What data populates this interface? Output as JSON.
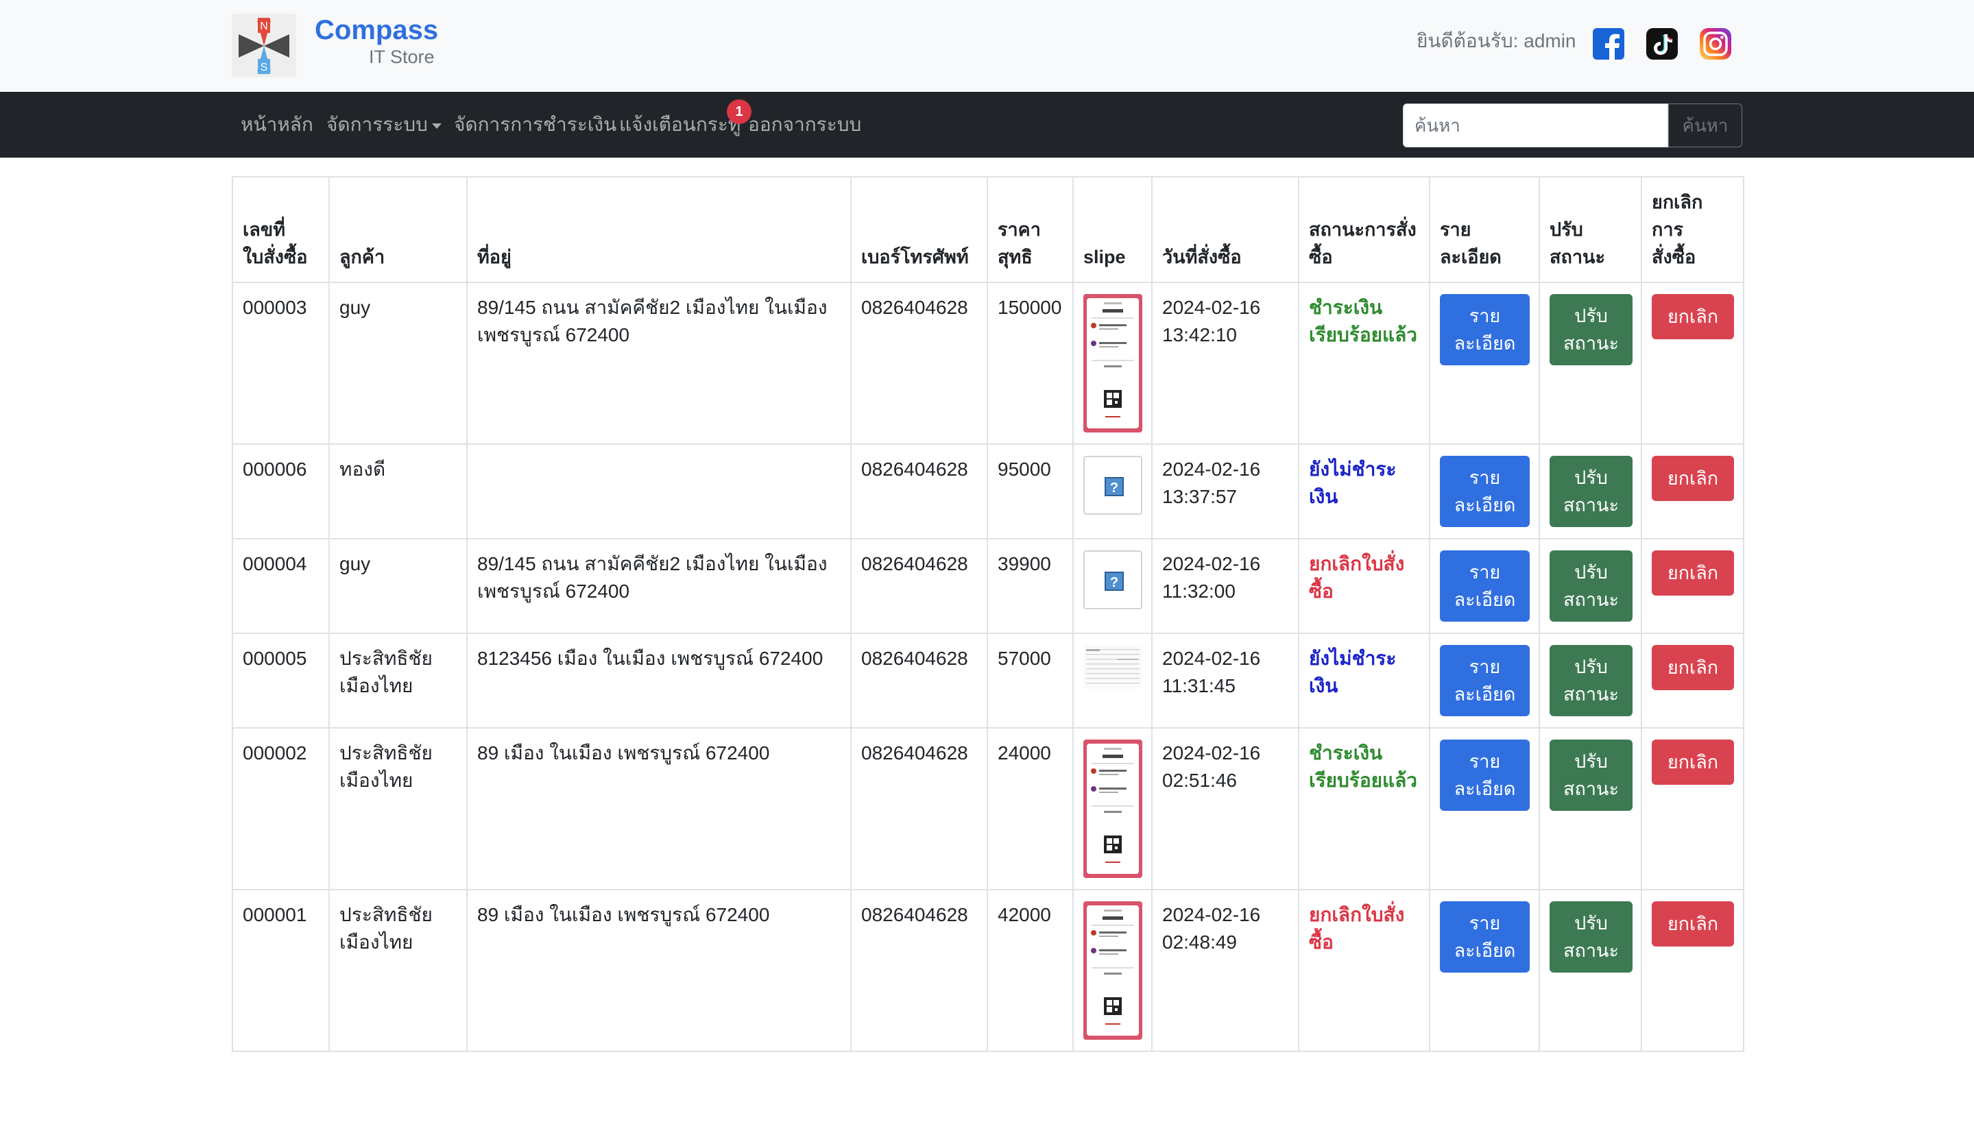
{
  "brand": {
    "name": "Compass",
    "subtitle": "IT Store",
    "logo_letters": {
      "north": "N",
      "south": "S"
    }
  },
  "header": {
    "welcome": "ยินดีต้อนรับ: admin",
    "social": [
      "facebook-icon",
      "tiktok-icon",
      "instagram-icon"
    ]
  },
  "nav": {
    "home": "หน้าหลัก",
    "manage_system": "จัดการระบบ",
    "manage_payment": "จัดการการชำระเงิน",
    "notifications": "แจ้งเตือนกระทู้",
    "notifications_badge": "1",
    "logout": "ออกจากระบบ"
  },
  "search": {
    "placeholder": "ค้นหา",
    "button": "ค้นหา"
  },
  "table": {
    "headers": {
      "order_no": [
        "เลขที่",
        "ใบสั่งซื้อ"
      ],
      "customer": "ลูกค้า",
      "address": "ที่อยู่",
      "phone": "เบอร์โทรศัพท์",
      "net_price": [
        "ราคา",
        "สุทธิ"
      ],
      "slip": "slipe",
      "order_date": "วันที่สั่งซื้อ",
      "status": [
        "สถานะการสั่ง",
        "ซื้อ"
      ],
      "details": [
        "ราย",
        "ละเอียด"
      ],
      "adjust": [
        "ปรับ",
        "สถานะ"
      ],
      "cancel": [
        "ยกเลิกการ",
        "สั่งซื้อ"
      ]
    },
    "buttons": {
      "details": [
        "ราย",
        "ละเอียด"
      ],
      "adjust": [
        "ปรับ",
        "สถานะ"
      ],
      "cancel": "ยกเลิก"
    },
    "rows": [
      {
        "order_no": "000003",
        "customer": "guy",
        "address": "89/145 ถนน สามัคคีชัย2 เมืองไทย ในเมือง เพชรบูรณ์ 672400",
        "phone": "0826404628",
        "net_price": "150000",
        "slip": "receipt",
        "date": "2024-02-16",
        "time": "13:42:10",
        "status": "ชำระเงินเรียบร้อยแล้ว",
        "status_type": "paid"
      },
      {
        "order_no": "000006",
        "customer": "ทองดี",
        "address": "",
        "phone": "0826404628",
        "net_price": "95000",
        "slip": "missing",
        "date": "2024-02-16",
        "time": "13:37:57",
        "status": "ยังไม่ชำระเงิน",
        "status_type": "unpaid"
      },
      {
        "order_no": "000004",
        "customer": "guy",
        "address": "89/145 ถนน สามัคคีชัย2 เมืองไทย ในเมือง เพชรบูรณ์ 672400",
        "phone": "0826404628",
        "net_price": "39900",
        "slip": "missing",
        "date": "2024-02-16",
        "time": "11:32:00",
        "status": "ยกเลิกใบสั่งซื้อ",
        "status_type": "cancel"
      },
      {
        "order_no": "000005",
        "customer": "ประสิทธิชัย เมืองไทย",
        "address": "8123456 เมือง ในเมือง เพชรบูรณ์ 672400",
        "phone": "0826404628",
        "net_price": "57000",
        "slip": "sheet",
        "date": "2024-02-16",
        "time": "11:31:45",
        "status": "ยังไม่ชำระเงิน",
        "status_type": "unpaid"
      },
      {
        "order_no": "000002",
        "customer": "ประสิทธิชัย เมืองไทย",
        "address": "89 เมือง ในเมือง เพชรบูรณ์ 672400",
        "phone": "0826404628",
        "net_price": "24000",
        "slip": "receipt",
        "date": "2024-02-16",
        "time": "02:51:46",
        "status": "ชำระเงินเรียบร้อยแล้ว",
        "status_type": "paid"
      },
      {
        "order_no": "000001",
        "customer": "ประสิทธิชัย เมืองไทย",
        "address": "89 เมือง ในเมือง เพชรบูรณ์ 672400",
        "phone": "0826404628",
        "net_price": "42000",
        "slip": "receipt",
        "date": "2024-02-16",
        "time": "02:48:49",
        "status": "ยกเลิกใบสั่งซื้อ",
        "status_type": "cancel"
      }
    ]
  },
  "colors": {
    "brand_blue": "#2f6fe0",
    "navbar_bg": "#212529",
    "status_paid": "#2e8b2e",
    "status_unpaid": "#1a22c9",
    "status_cancel": "#dc3545",
    "btn_detail": "#2f6fe0",
    "btn_adjust": "#3d7a53",
    "btn_cancel": "#d9434f"
  }
}
